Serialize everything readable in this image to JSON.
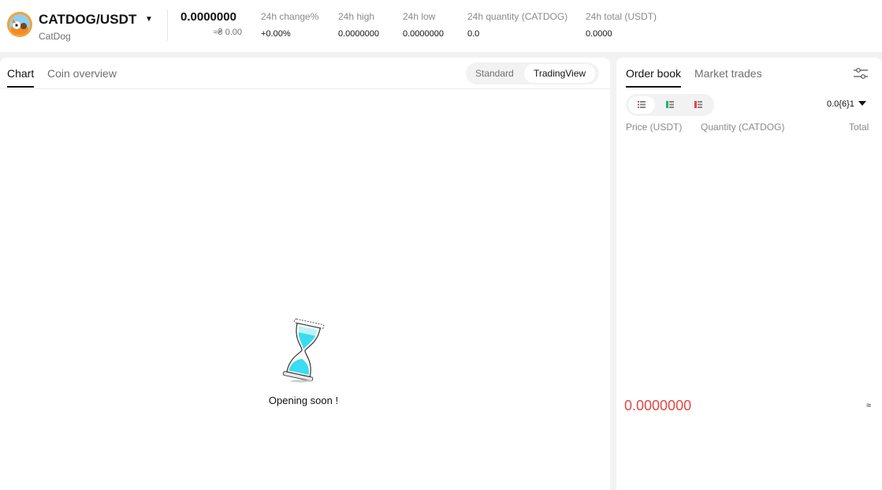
{
  "ticker": {
    "pair": "CATDOG/USDT",
    "coin_name": "CatDog",
    "last_price": "0.0000000",
    "last_price_fiat": "≈₴ 0.00",
    "stats": [
      {
        "label": "24h change%",
        "value": "+0.00%"
      },
      {
        "label": "24h high",
        "value": "0.0000000"
      },
      {
        "label": "24h low",
        "value": "0.0000000"
      },
      {
        "label": "24h quantity (CATDOG)",
        "value": "0.0"
      },
      {
        "label": "24h total (USDT)",
        "value": "0.0000"
      }
    ]
  },
  "chart_panel": {
    "tabs": [
      "Chart",
      "Coin overview"
    ],
    "view_options": [
      "Standard",
      "TradingView"
    ],
    "status_text": "Opening soon !"
  },
  "order_book": {
    "tabs": [
      "Order book",
      "Market trades"
    ],
    "precision": "0.0{6}1",
    "columns": [
      "Price (USDT)",
      "Quantity (CATDOG)",
      "Total"
    ],
    "mid_price": "0.0000000",
    "mid_approx": "≈"
  },
  "colors": {
    "sell_red": "#e64545",
    "buy_green": "#20b26c",
    "hourglass_cyan": "#39dcf0"
  }
}
